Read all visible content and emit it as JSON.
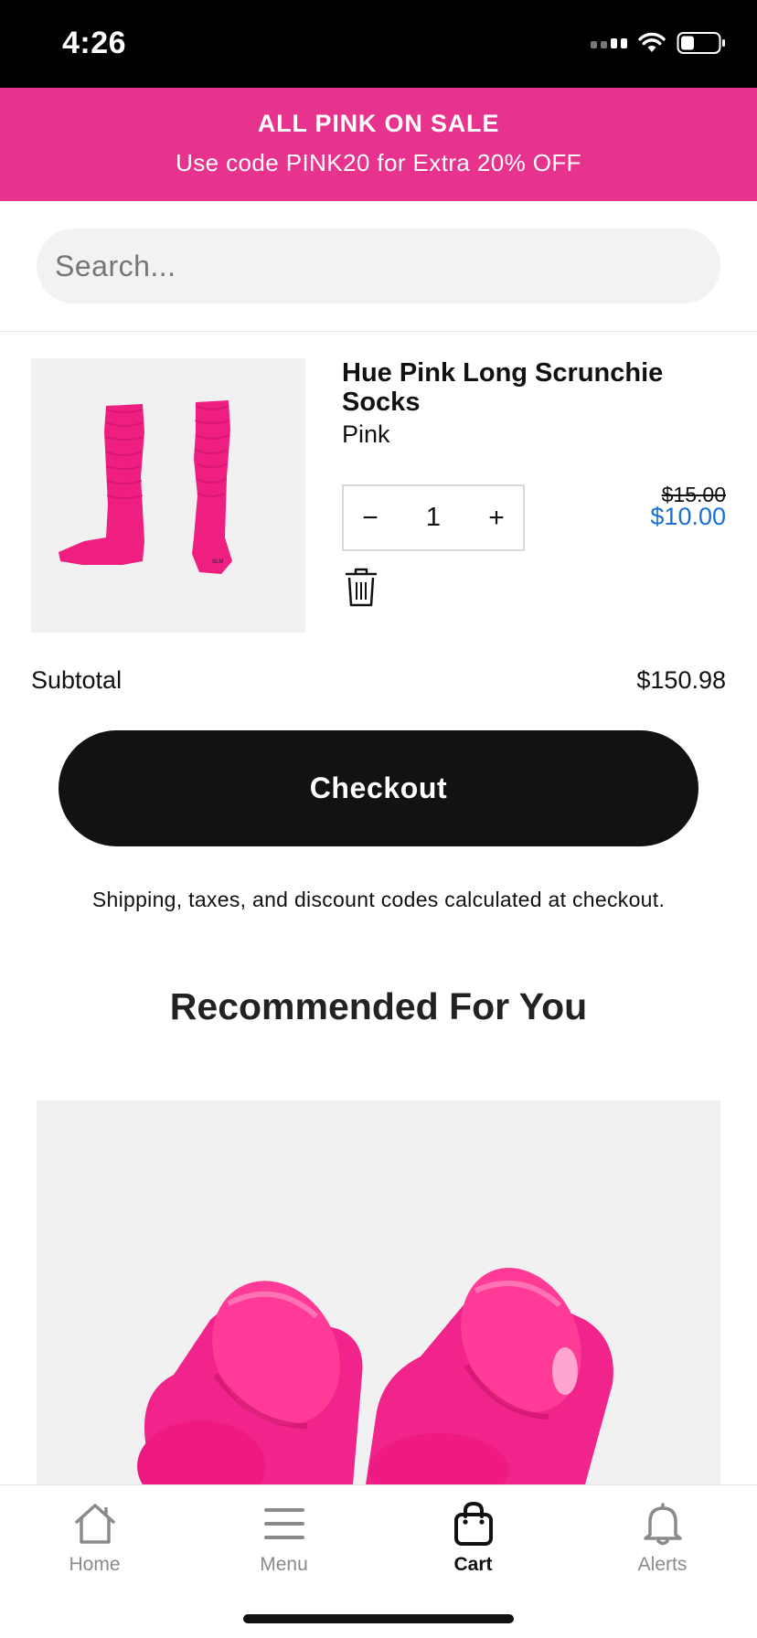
{
  "status_bar": {
    "time": "4:26"
  },
  "promo": {
    "title": "ALL PINK ON SALE",
    "subtitle": "Use code PINK20 for Extra 20% OFF",
    "background": "#e8338e"
  },
  "search": {
    "placeholder": "Search...",
    "value": ""
  },
  "cart_item": {
    "name": "Hue Pink Long Scrunchie Socks",
    "variant": "Pink",
    "quantity": "1",
    "decrement_icon": "−",
    "increment_icon": "+",
    "price_original": "$15.00",
    "price_sale": "$10.00",
    "sale_color": "#1a6fd6",
    "image": "pink-scrunchie-socks",
    "remove_icon": "trash-icon"
  },
  "subtotal": {
    "label": "Subtotal",
    "value": "$150.98"
  },
  "checkout": {
    "label": "Checkout"
  },
  "shipping_note": "Shipping, taxes, and discount codes calculated at checkout.",
  "recommended": {
    "title": "Recommended For You",
    "image": "pink-lace-locks"
  },
  "tab_bar": {
    "tabs": [
      {
        "label": "Home",
        "icon": "home-icon"
      },
      {
        "label": "Menu",
        "icon": "menu-icon"
      },
      {
        "label": "Cart",
        "icon": "bag-icon",
        "active": true
      },
      {
        "label": "Alerts",
        "icon": "bell-icon"
      }
    ]
  }
}
